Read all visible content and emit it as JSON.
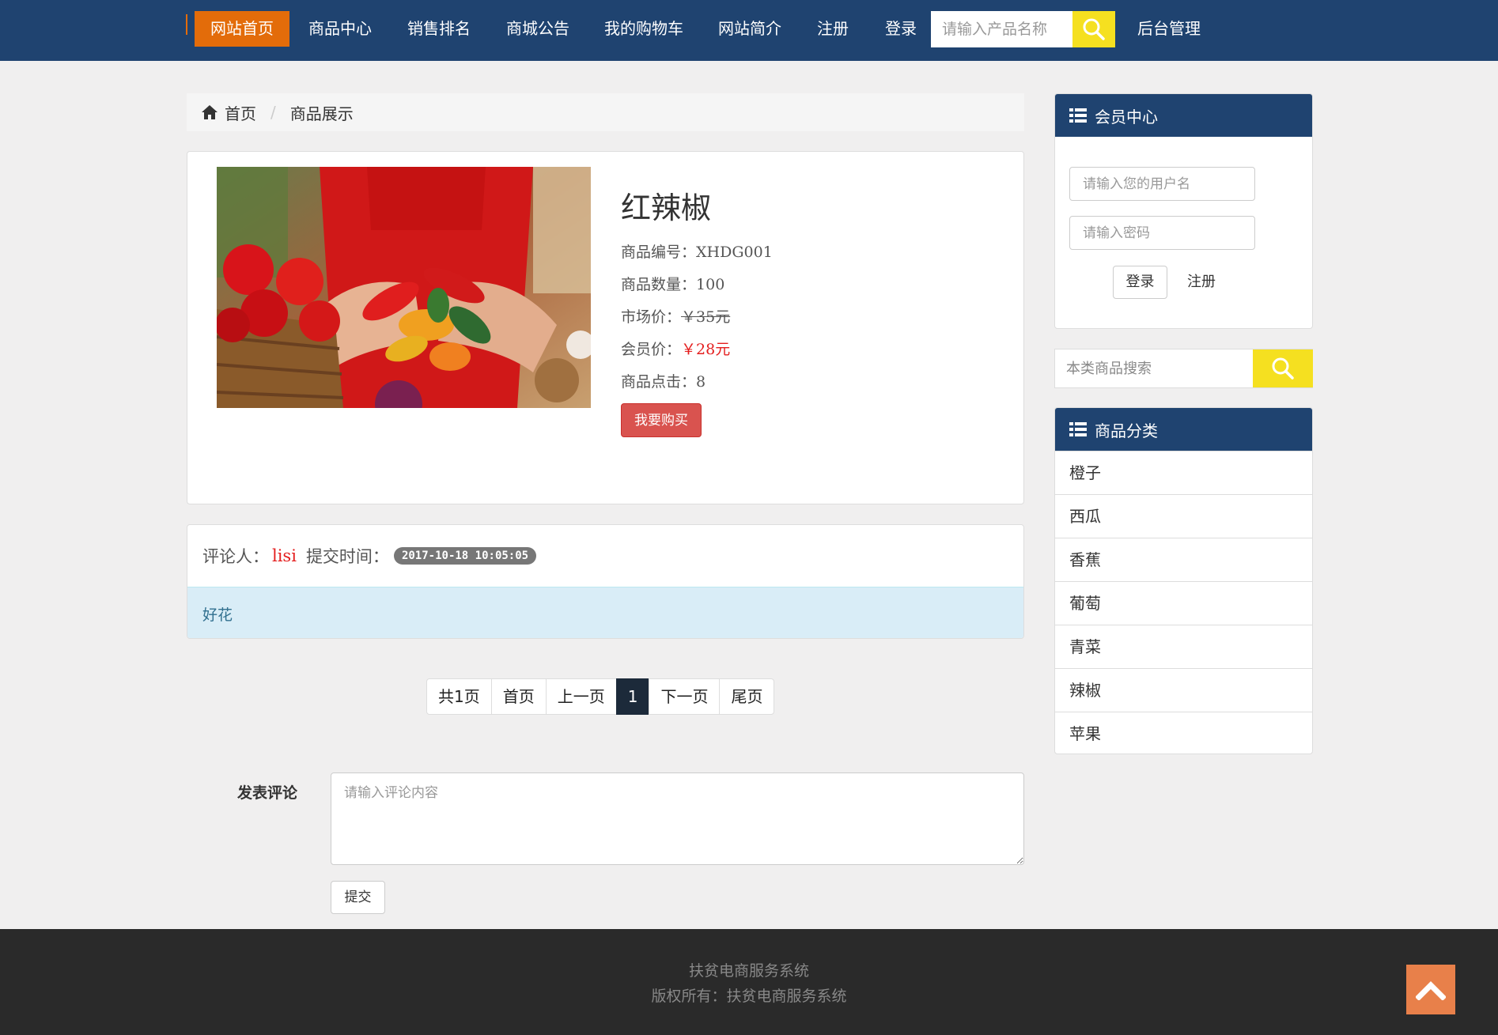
{
  "nav": {
    "items": [
      "网站首页",
      "商品中心",
      "销售排名",
      "商城公告",
      "我的购物车",
      "网站简介",
      "注册",
      "登录"
    ],
    "search_placeholder": "请输入产品名称",
    "admin_label": "后台管理",
    "accent_color": "#e36c0a",
    "bg_color": "#1f4370"
  },
  "breadcrumb": {
    "home": "首页",
    "current": "商品展示"
  },
  "product": {
    "title": "红辣椒",
    "code_label": "商品编号：",
    "code": "XHDG001",
    "qty_label": "商品数量：",
    "qty": "100",
    "market_label": "市场价：",
    "market_price": "￥35元",
    "member_label": "会员价：",
    "member_price": "￥28元",
    "clicks_label": "商品点击：",
    "clicks": "8",
    "buy_label": "我要购买"
  },
  "comment": {
    "reviewer_label": "评论人：",
    "reviewer": "lisi",
    "time_label": "提交时间：",
    "time": "2017-10-18 10:05:05",
    "content": "好花"
  },
  "pagination": {
    "total": "共1页",
    "first": "首页",
    "prev": "上一页",
    "current": "1",
    "next": "下一页",
    "last": "尾页"
  },
  "comment_form": {
    "label": "发表评论",
    "placeholder": "请输入评论内容",
    "submit": "提交"
  },
  "member": {
    "title": "会员中心",
    "username_placeholder": "请输入您的用户名",
    "password_placeholder": "请输入密码",
    "login": "登录",
    "register": "注册"
  },
  "category_search": {
    "placeholder": "本类商品搜索"
  },
  "categories": {
    "title": "商品分类",
    "items": [
      "橙子",
      "西瓜",
      "香蕉",
      "葡萄",
      "青菜",
      "辣椒",
      "苹果"
    ]
  },
  "footer": {
    "line1": "扶贫电商服务系统",
    "line2": "版权所有：扶贫电商服务系统"
  }
}
